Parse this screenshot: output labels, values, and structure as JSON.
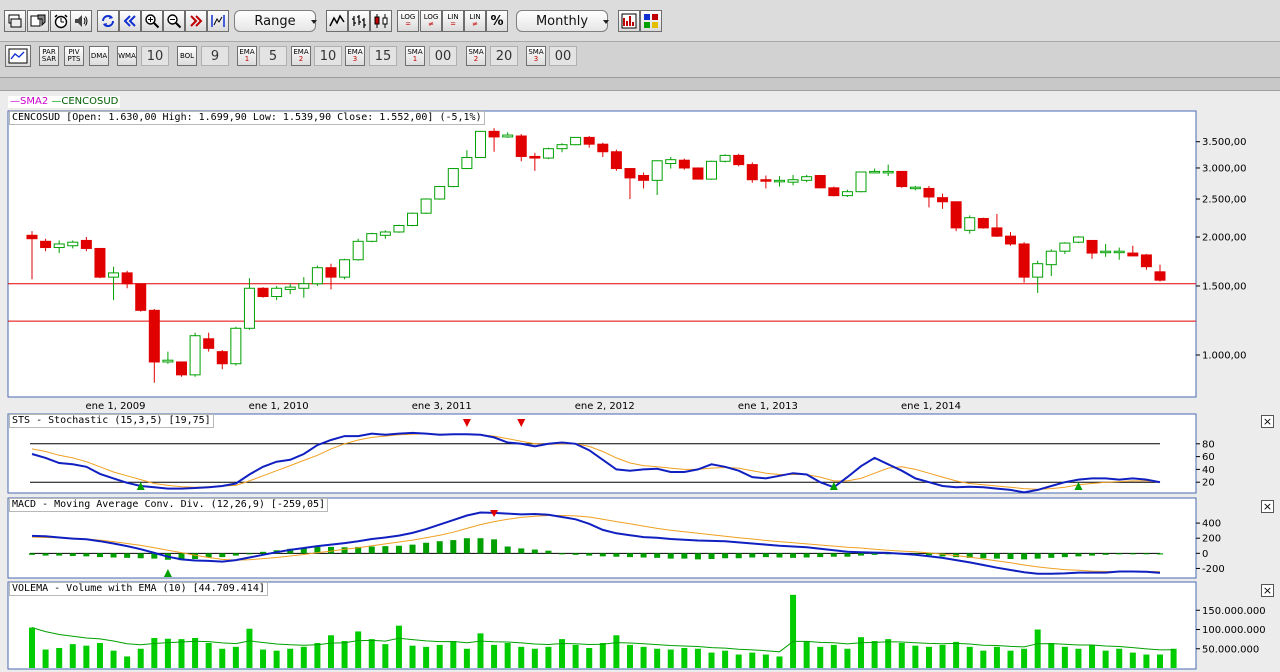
{
  "toolbar1": {
    "range_label": "Range",
    "interval_label": "Monthly",
    "text_buttons": [
      {
        "a": "LOG",
        "b": "="
      },
      {
        "a": "LOG",
        "b": "≠"
      },
      {
        "a": "LIN",
        "b": "="
      },
      {
        "a": "LIN",
        "b": "≠"
      }
    ],
    "percent_label": "%"
  },
  "toolbar2": {
    "par_sar": {
      "a": "PAR",
      "b": "SAR"
    },
    "piv_pts": {
      "a": "PIV",
      "b": "PTS"
    },
    "dma_label": "DMA",
    "wma_label": "WMA",
    "wma_value": "10",
    "bol_label": "BOL",
    "bol_value": "9",
    "ema": [
      {
        "a": "EMA",
        "b": "1",
        "value": "5"
      },
      {
        "a": "EMA",
        "b": "2",
        "value": "10"
      },
      {
        "a": "EMA",
        "b": "3",
        "value": "15"
      }
    ],
    "sma": [
      {
        "a": "SMA",
        "b": "1",
        "value": "00"
      },
      {
        "a": "SMA",
        "b": "2",
        "value": "20"
      },
      {
        "a": "SMA",
        "b": "3",
        "value": "00"
      }
    ]
  },
  "legend": {
    "sma": "SMA2",
    "symbol": "CENCOSUD"
  },
  "colors": {
    "up": "#00a000",
    "down": "#e00000",
    "ma": "#f0a020",
    "main": "#1020c0",
    "sma": "#cc00cc",
    "volume": "#00cc00"
  },
  "price_panel": {
    "label": "CENCOSUD [Open: 1.630,00  High: 1.699,90  Low: 1.539,90  Close: 1.552,00] (-5,1%)",
    "y_ticks": [
      "3.500,00",
      "3.000,00",
      "2.500,00",
      "2.000,00",
      "1.500,00",
      "1.000,00"
    ],
    "x_ticks": [
      "ene 1, 2009",
      "ene 1, 2010",
      "ene 3, 2011",
      "ene 2, 2012",
      "ene 1, 2013",
      "ene 1, 2014"
    ],
    "horizontal_lines": [
      1520,
      1220
    ]
  },
  "stochastic_panel": {
    "label": "STS - Stochastic (15,3,5) [19,75]",
    "y_ticks": [
      "80",
      "60",
      "40",
      "20"
    ],
    "levels": [
      80,
      20
    ],
    "close_label": "×"
  },
  "macd_panel": {
    "label": "MACD - Moving Average Conv. Div. (12,26,9) [-259,05]",
    "y_ticks": [
      "400",
      "200",
      "0",
      "-200"
    ],
    "close_label": "×"
  },
  "volume_panel": {
    "label": "VOLEMA - Volume with EMA (10) [44.709.414]",
    "y_ticks": [
      "150.000.000",
      "100.000.000",
      "50.000.000"
    ],
    "close_label": "×"
  },
  "chart_data": {
    "type": "candlestick",
    "interval": "monthly",
    "candles": [
      {
        "o": 2020,
        "h": 2070,
        "l": 1560,
        "c": 1980
      },
      {
        "o": 1950,
        "h": 1980,
        "l": 1840,
        "c": 1880
      },
      {
        "o": 1880,
        "h": 1960,
        "l": 1820,
        "c": 1920
      },
      {
        "o": 1900,
        "h": 1960,
        "l": 1870,
        "c": 1940
      },
      {
        "o": 1960,
        "h": 2000,
        "l": 1840,
        "c": 1870
      },
      {
        "o": 1870,
        "h": 1870,
        "l": 1570,
        "c": 1580
      },
      {
        "o": 1580,
        "h": 1680,
        "l": 1380,
        "c": 1620
      },
      {
        "o": 1620,
        "h": 1640,
        "l": 1480,
        "c": 1520
      },
      {
        "o": 1520,
        "h": 1520,
        "l": 1290,
        "c": 1300
      },
      {
        "o": 1300,
        "h": 1310,
        "l": 850,
        "c": 960
      },
      {
        "o": 960,
        "h": 1020,
        "l": 950,
        "c": 970
      },
      {
        "o": 960,
        "h": 960,
        "l": 880,
        "c": 890
      },
      {
        "o": 890,
        "h": 1140,
        "l": 880,
        "c": 1120
      },
      {
        "o": 1100,
        "h": 1140,
        "l": 1020,
        "c": 1040
      },
      {
        "o": 1020,
        "h": 1030,
        "l": 920,
        "c": 950
      },
      {
        "o": 950,
        "h": 1180,
        "l": 940,
        "c": 1170
      },
      {
        "o": 1170,
        "h": 1570,
        "l": 1160,
        "c": 1480
      },
      {
        "o": 1480,
        "h": 1490,
        "l": 1400,
        "c": 1410
      },
      {
        "o": 1410,
        "h": 1500,
        "l": 1380,
        "c": 1480
      },
      {
        "o": 1470,
        "h": 1520,
        "l": 1430,
        "c": 1490
      },
      {
        "o": 1480,
        "h": 1580,
        "l": 1400,
        "c": 1520
      },
      {
        "o": 1520,
        "h": 1690,
        "l": 1500,
        "c": 1670
      },
      {
        "o": 1670,
        "h": 1710,
        "l": 1470,
        "c": 1580
      },
      {
        "o": 1580,
        "h": 1760,
        "l": 1560,
        "c": 1750
      },
      {
        "o": 1750,
        "h": 1980,
        "l": 1740,
        "c": 1950
      },
      {
        "o": 1950,
        "h": 2050,
        "l": 1940,
        "c": 2040
      },
      {
        "o": 2020,
        "h": 2080,
        "l": 1980,
        "c": 2060
      },
      {
        "o": 2060,
        "h": 2150,
        "l": 2050,
        "c": 2140
      },
      {
        "o": 2140,
        "h": 2310,
        "l": 2130,
        "c": 2300
      },
      {
        "o": 2300,
        "h": 2510,
        "l": 2290,
        "c": 2500
      },
      {
        "o": 2500,
        "h": 2700,
        "l": 2490,
        "c": 2690
      },
      {
        "o": 2690,
        "h": 3000,
        "l": 2680,
        "c": 2990
      },
      {
        "o": 2990,
        "h": 3330,
        "l": 2980,
        "c": 3190
      },
      {
        "o": 3190,
        "h": 3730,
        "l": 3180,
        "c": 3720
      },
      {
        "o": 3720,
        "h": 3790,
        "l": 3300,
        "c": 3600
      },
      {
        "o": 3600,
        "h": 3700,
        "l": 3580,
        "c": 3640
      },
      {
        "o": 3620,
        "h": 3660,
        "l": 3120,
        "c": 3210
      },
      {
        "o": 3210,
        "h": 3280,
        "l": 2950,
        "c": 3180
      },
      {
        "o": 3180,
        "h": 3380,
        "l": 3160,
        "c": 3360
      },
      {
        "o": 3360,
        "h": 3470,
        "l": 3290,
        "c": 3440
      },
      {
        "o": 3440,
        "h": 3600,
        "l": 3430,
        "c": 3590
      },
      {
        "o": 3590,
        "h": 3620,
        "l": 3380,
        "c": 3450
      },
      {
        "o": 3450,
        "h": 3480,
        "l": 3200,
        "c": 3300
      },
      {
        "o": 3300,
        "h": 3340,
        "l": 2950,
        "c": 2990
      },
      {
        "o": 2990,
        "h": 3000,
        "l": 2500,
        "c": 2830
      },
      {
        "o": 2870,
        "h": 2920,
        "l": 2660,
        "c": 2790
      },
      {
        "o": 2790,
        "h": 3130,
        "l": 2560,
        "c": 3130
      },
      {
        "o": 3080,
        "h": 3200,
        "l": 2990,
        "c": 3150
      },
      {
        "o": 3140,
        "h": 3170,
        "l": 2970,
        "c": 3000
      },
      {
        "o": 3000,
        "h": 3010,
        "l": 2810,
        "c": 2810
      },
      {
        "o": 2810,
        "h": 3130,
        "l": 2800,
        "c": 3120
      },
      {
        "o": 3120,
        "h": 3250,
        "l": 3100,
        "c": 3230
      },
      {
        "o": 3230,
        "h": 3260,
        "l": 3030,
        "c": 3060
      },
      {
        "o": 3060,
        "h": 3100,
        "l": 2750,
        "c": 2800
      },
      {
        "o": 2800,
        "h": 2870,
        "l": 2660,
        "c": 2790
      },
      {
        "o": 2790,
        "h": 2860,
        "l": 2690,
        "c": 2790
      },
      {
        "o": 2760,
        "h": 2880,
        "l": 2710,
        "c": 2800
      },
      {
        "o": 2790,
        "h": 2880,
        "l": 2760,
        "c": 2850
      },
      {
        "o": 2870,
        "h": 2880,
        "l": 2660,
        "c": 2670
      },
      {
        "o": 2670,
        "h": 2690,
        "l": 2540,
        "c": 2550
      },
      {
        "o": 2550,
        "h": 2640,
        "l": 2530,
        "c": 2610
      },
      {
        "o": 2610,
        "h": 2930,
        "l": 2600,
        "c": 2930
      },
      {
        "o": 2930,
        "h": 2990,
        "l": 2910,
        "c": 2940
      },
      {
        "o": 2930,
        "h": 3060,
        "l": 2860,
        "c": 2940
      },
      {
        "o": 2940,
        "h": 2940,
        "l": 2670,
        "c": 2690
      },
      {
        "o": 2670,
        "h": 2700,
        "l": 2630,
        "c": 2680
      },
      {
        "o": 2660,
        "h": 2700,
        "l": 2380,
        "c": 2530
      },
      {
        "o": 2520,
        "h": 2580,
        "l": 2360,
        "c": 2460
      },
      {
        "o": 2460,
        "h": 2460,
        "l": 2070,
        "c": 2110
      },
      {
        "o": 2080,
        "h": 2270,
        "l": 2040,
        "c": 2240
      },
      {
        "o": 2230,
        "h": 2240,
        "l": 2100,
        "c": 2110
      },
      {
        "o": 2110,
        "h": 2290,
        "l": 2000,
        "c": 2010
      },
      {
        "o": 2010,
        "h": 2060,
        "l": 1900,
        "c": 1920
      },
      {
        "o": 1920,
        "h": 1940,
        "l": 1530,
        "c": 1580
      },
      {
        "o": 1580,
        "h": 1740,
        "l": 1440,
        "c": 1710
      },
      {
        "o": 1700,
        "h": 1860,
        "l": 1590,
        "c": 1840
      },
      {
        "o": 1840,
        "h": 1940,
        "l": 1810,
        "c": 1930
      },
      {
        "o": 1940,
        "h": 2010,
        "l": 1930,
        "c": 2000
      },
      {
        "o": 1960,
        "h": 1960,
        "l": 1760,
        "c": 1820
      },
      {
        "o": 1830,
        "h": 1920,
        "l": 1780,
        "c": 1840
      },
      {
        "o": 1840,
        "h": 1880,
        "l": 1750,
        "c": 1840
      },
      {
        "o": 1820,
        "h": 1900,
        "l": 1790,
        "c": 1790
      },
      {
        "o": 1800,
        "h": 1810,
        "l": 1650,
        "c": 1680
      },
      {
        "o": 1630,
        "h": 1700,
        "l": 1540,
        "c": 1552
      }
    ],
    "sma2": [
      1990,
      1930,
      1900,
      1930,
      1905,
      1725,
      1600,
      1570,
      1410,
      1130,
      965,
      930,
      1005,
      1080,
      995,
      1060,
      1325,
      1445,
      1445,
      1485,
      1505,
      1595,
      1625,
      1665,
      1850,
      1995,
      2050,
      2100,
      2220,
      2400,
      2595,
      2840,
      3090,
      3455,
      3660,
      3620,
      3425,
      3195,
      3270,
      3400,
      3515,
      3520,
      3375,
      3145,
      2910,
      2810,
      2960,
      3140,
      3075,
      2905,
      2965,
      3175,
      3145,
      2930,
      2795,
      2790,
      2795,
      2825,
      2760,
      2610,
      2580,
      2770,
      2935,
      2940,
      2815,
      2685,
      2605,
      2495,
      2285,
      2175,
      2175,
      2060,
      1965,
      1750,
      1645,
      1775,
      1885,
      1965,
      1910,
      1830,
      1840,
      1815,
      1735,
      1616
    ],
    "stochastic_k": [
      64,
      58,
      50,
      48,
      44,
      33,
      26,
      19,
      14,
      12,
      10,
      10,
      11,
      12,
      14,
      18,
      32,
      44,
      52,
      55,
      64,
      78,
      86,
      92,
      92,
      96,
      94,
      96,
      97,
      96,
      94,
      95,
      95,
      94,
      90,
      82,
      80,
      76,
      80,
      82,
      80,
      70,
      55,
      40,
      38,
      40,
      41,
      36,
      36,
      40,
      48,
      44,
      38,
      28,
      26,
      30,
      34,
      32,
      20,
      12,
      28,
      45,
      58,
      48,
      38,
      26,
      20,
      14,
      12,
      13,
      12,
      10,
      8,
      4,
      8,
      14,
      20,
      24,
      26,
      26,
      24,
      26,
      24,
      20
    ],
    "stochastic_d": [
      72,
      68,
      62,
      58,
      52,
      44,
      36,
      30,
      24,
      18,
      15,
      13,
      12,
      13,
      14,
      15,
      22,
      30,
      38,
      46,
      54,
      62,
      72,
      80,
      86,
      90,
      92,
      94,
      95,
      96,
      95,
      95,
      95,
      94,
      92,
      88,
      84,
      80,
      79,
      80,
      80,
      76,
      68,
      58,
      50,
      46,
      44,
      42,
      40,
      40,
      42,
      43,
      42,
      38,
      34,
      32,
      32,
      32,
      28,
      22,
      22,
      26,
      34,
      42,
      44,
      40,
      34,
      28,
      22,
      18,
      16,
      14,
      12,
      10,
      9,
      10,
      12,
      16,
      18,
      20,
      21,
      22,
      22,
      21
    ],
    "macd": [
      230,
      225,
      210,
      195,
      185,
      160,
      130,
      95,
      55,
      5,
      -45,
      -80,
      -95,
      -100,
      -110,
      -90,
      -55,
      -20,
      15,
      45,
      70,
      95,
      115,
      135,
      160,
      190,
      210,
      235,
      270,
      320,
      380,
      440,
      500,
      540,
      535,
      525,
      515,
      520,
      510,
      480,
      450,
      390,
      310,
      265,
      240,
      215,
      205,
      190,
      180,
      170,
      165,
      160,
      145,
      130,
      115,
      100,
      90,
      80,
      60,
      40,
      20,
      15,
      10,
      5,
      -5,
      -20,
      -40,
      -60,
      -90,
      -120,
      -155,
      -190,
      -220,
      -250,
      -270,
      -270,
      -265,
      -255,
      -255,
      -255,
      -240,
      -240,
      -245,
      -259
    ],
    "macd_signal": [
      215,
      210,
      205,
      200,
      190,
      175,
      155,
      130,
      105,
      75,
      40,
      10,
      -25,
      -55,
      -80,
      -90,
      -85,
      -70,
      -55,
      -35,
      -15,
      10,
      30,
      55,
      75,
      100,
      125,
      150,
      175,
      205,
      240,
      280,
      330,
      380,
      420,
      450,
      475,
      490,
      500,
      500,
      495,
      480,
      450,
      420,
      390,
      360,
      330,
      305,
      285,
      265,
      245,
      225,
      205,
      190,
      170,
      155,
      140,
      125,
      110,
      95,
      80,
      70,
      55,
      40,
      30,
      20,
      5,
      -10,
      -30,
      -50,
      -75,
      -100,
      -125,
      -155,
      -180,
      -200,
      -215,
      -225,
      -235,
      -240,
      -240,
      -240,
      -240,
      -242
    ],
    "macd_hist": [
      -20,
      -30,
      -30,
      -35,
      -40,
      -50,
      -55,
      -60,
      -65,
      -70,
      -85,
      -90,
      -75,
      -55,
      -50,
      -30,
      -5,
      20,
      40,
      60,
      75,
      85,
      85,
      80,
      85,
      90,
      95,
      100,
      115,
      140,
      160,
      175,
      200,
      200,
      185,
      90,
      65,
      50,
      35,
      -5,
      -20,
      -30,
      -40,
      -45,
      -50,
      -55,
      -60,
      -70,
      -70,
      -80,
      -75,
      -65,
      -65,
      -55,
      -50,
      -55,
      -60,
      -55,
      -50,
      -45,
      -45,
      -30,
      -20,
      -10,
      -15,
      -15,
      -25,
      -40,
      -50,
      -60,
      -65,
      -70,
      -75,
      -80,
      -70,
      -60,
      -50,
      -40,
      -30,
      -20,
      -10,
      0,
      -5,
      -15
    ],
    "volume": [
      105,
      48,
      52,
      62,
      58,
      65,
      45,
      30,
      50,
      78,
      76,
      75,
      78,
      65,
      50,
      55,
      102,
      48,
      45,
      50,
      55,
      65,
      85,
      70,
      95,
      75,
      62,
      110,
      58,
      55,
      60,
      70,
      50,
      90,
      60,
      65,
      55,
      50,
      55,
      75,
      60,
      52,
      65,
      85,
      60,
      55,
      50,
      48,
      52,
      50,
      40,
      45,
      35,
      40,
      35,
      30,
      190,
      70,
      55,
      60,
      50,
      80,
      70,
      75,
      65,
      58,
      55,
      60,
      68,
      55,
      45,
      55,
      45,
      50,
      100,
      65,
      55,
      50,
      60,
      45,
      50,
      40,
      35,
      35,
      50
    ]
  }
}
